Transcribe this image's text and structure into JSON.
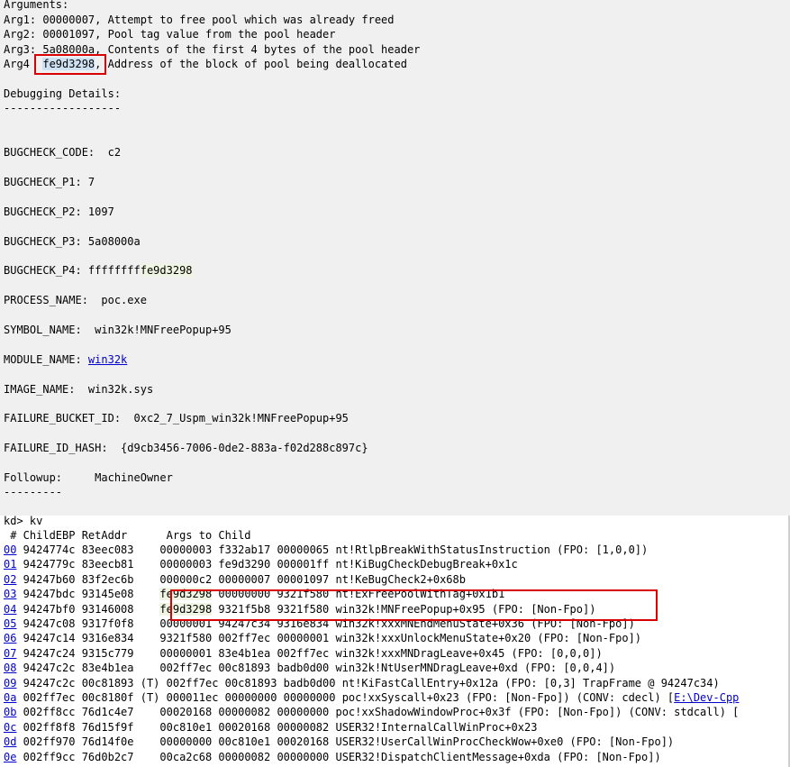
{
  "debug": {
    "args_header": "Arguments:",
    "args": [
      {
        "label": "Arg1:",
        "value": "00000007",
        "desc": ", Attempt to free pool which was already freed"
      },
      {
        "label": "Arg2:",
        "value": "00001097",
        "desc": ", Pool tag value from the pool header"
      },
      {
        "label": "Arg3:",
        "value": "5a08000a",
        "desc": ", Contents of the first 4 bytes of the pool header"
      },
      {
        "label": "Arg4",
        "value": "fe9d3298",
        "desc": ", Address of the block of pool being deallocated"
      }
    ],
    "details_header": "Debugging Details:",
    "details_rule": "------------------",
    "bugcheck_code": "BUGCHECK_CODE:  c2",
    "p1": "BUGCHECK_P1: 7",
    "p2": "BUGCHECK_P2: 1097",
    "p3": "BUGCHECK_P3: 5a08000a",
    "p4_prefix": "BUGCHECK_P4: ffffffff",
    "p4_value": "fe9d3298",
    "process_name": "PROCESS_NAME:  poc.exe",
    "symbol_name": "SYMBOL_NAME:  win32k!MNFreePopup+95",
    "module_label": "MODULE_NAME: ",
    "module_link": "win32k",
    "image_name": "IMAGE_NAME:  win32k.sys",
    "failure_bucket": "FAILURE_BUCKET_ID:  0xc2_7_Uspm_win32k!MNFreePopup+95",
    "failure_hash": "FAILURE_ID_HASH:  {d9cb3456-7006-0de2-883a-f02d288c897c}",
    "followup": "Followup:     MachineOwner",
    "followup_rule": "---------"
  },
  "stack": {
    "prompt": "kd> kv",
    "header": " # ChildEBP RetAddr      Args to Child",
    "frames": [
      {
        "num": "00",
        "ebp": " 9424774c 83eec083    ",
        "a1": "00000003",
        "rest": " f332ab17 00000065 nt!RtlpBreakWithStatusInstruction (FPO: [1,0,0])"
      },
      {
        "num": "01",
        "ebp": " 9424779c 83eecb81    ",
        "a1": "00000003",
        "rest": " fe9d3290 000001ff nt!KiBugCheckDebugBreak+0x1c"
      },
      {
        "num": "02",
        "ebp": " 94247b60 83f2ec6b    ",
        "a1": "000000c2",
        "rest": " 00000007 00001097 nt!KeBugCheck2+0x68b"
      },
      {
        "num": "03",
        "ebp": " 94247bdc 93145e08    ",
        "a1": "fe9d3298",
        "rest": " 00000000 9321f580 nt!ExFreePoolWithTag+0x1b1"
      },
      {
        "num": "04",
        "ebp": " 94247bf0 93146008    ",
        "a1": "fe9d3298",
        "rest": " 9321f5b8 9321f580 win32k!MNFreePopup+0x95 (FPO: [Non-Fpo])"
      },
      {
        "num": "05",
        "ebp": " 94247c08 9317f0f8    ",
        "a1": "00000001",
        "rest": " 94247c34 9316e834 win32k!xxxMNEndMenuState+0x36 (FPO: [Non-Fpo])"
      },
      {
        "num": "06",
        "ebp": " 94247c14 9316e834    ",
        "a1": "9321f580",
        "rest": " 002ff7ec 00000001 win32k!xxxUnlockMenuState+0x20 (FPO: [Non-Fpo])"
      },
      {
        "num": "07",
        "ebp": " 94247c24 9315c779    ",
        "a1": "00000001",
        "rest": " 83e4b1ea 002ff7ec win32k!xxxMNDragLeave+0x45 (FPO: [0,0,0])"
      },
      {
        "num": "08",
        "ebp": " 94247c2c 83e4b1ea    ",
        "a1": "002ff7ec",
        "rest": " 00c81893 badb0d00 win32k!NtUserMNDragLeave+0xd (FPO: [0,0,4])"
      },
      {
        "num": "09",
        "ebp": " 94247c2c 00c81893 (T) ",
        "a1": "002ff7ec",
        "rest": " 00c81893 badb0d00 nt!KiFastCallEntry+0x12a (FPO: [0,3] TrapFrame @ 94247c34)"
      },
      {
        "num": "0a",
        "ebp": " 002ff7ec 00c8180f (T) ",
        "a1": "000011ec",
        "rest": " 00000000 00000000 poc!xxSyscall+0x23 (FPO: [Non-Fpo]) (CONV: cdecl) [",
        "link": "E:\\Dev-Cpp"
      },
      {
        "num": "0b",
        "ebp": " 002ff8cc 76d1c4e7    ",
        "a1": "00020168",
        "rest": " 00000082 00000000 poc!xxShadowWindowProc+0x3f (FPO: [Non-Fpo]) (CONV: stdcall) ["
      },
      {
        "num": "0c",
        "ebp": " 002ff8f8 76d15f9f    ",
        "a1": "00c810e1",
        "rest": " 00020168 00000082 USER32!InternalCallWinProc+0x23"
      },
      {
        "num": "0d",
        "ebp": " 002ff970 76d14f0e    ",
        "a1": "00000000",
        "rest": " 00c810e1 00020168 USER32!UserCallWinProcCheckWow+0xe0 (FPO: [Non-Fpo])"
      },
      {
        "num": "0e",
        "ebp": " 002ff9cc 76d0b2c7    ",
        "a1": "00ca2c68",
        "rest": " 00000082 00000000 USER32!DispatchClientMessage+0xda (FPO: [Non-Fpo])"
      }
    ]
  }
}
